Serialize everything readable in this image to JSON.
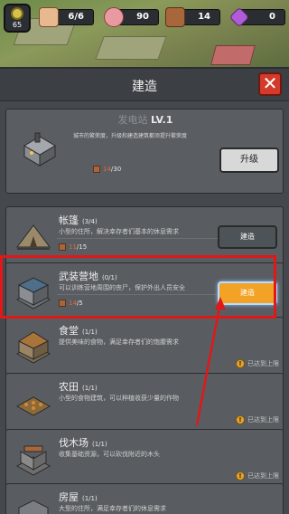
{
  "topbar": {
    "level": "65",
    "resources": [
      {
        "icon": "people-icon",
        "value": "6/6"
      },
      {
        "icon": "meat-icon",
        "value": "90"
      },
      {
        "icon": "wood-icon",
        "value": "14"
      },
      {
        "icon": "gem-icon",
        "value": "0"
      }
    ]
  },
  "modal": {
    "title": "建造",
    "close_label": "✕"
  },
  "power": {
    "name": "发电站",
    "level": "LV.1",
    "description": "城市的繁荣度，升级和建造建筑都须提升繁荣度",
    "cost_have": "14",
    "cost_need": "/30",
    "upgrade_label": "升级"
  },
  "buildings": [
    {
      "name": "帐篷",
      "count": "(3/4)",
      "description": "小型的住所，解决幸存者们基本的休息需求",
      "cost_have": "11",
      "cost_need": "/15",
      "button": "建造",
      "maxed": ""
    },
    {
      "name": "武装营地",
      "count": "(0/1)",
      "description": "可以训练营地周围的丧尸，保护外出人员安全",
      "cost_have": "14",
      "cost_need": "/5",
      "button": "建造",
      "maxed": ""
    },
    {
      "name": "食堂",
      "count": "(1/1)",
      "description": "提供美味的食物，满足幸存者们的饱腹需求",
      "cost_have": "",
      "cost_need": "",
      "button": "",
      "maxed": "已达到上限"
    },
    {
      "name": "农田",
      "count": "(1/1)",
      "description": "小型的食物建筑，可以种植收获少量的作物",
      "cost_have": "",
      "cost_need": "",
      "button": "",
      "maxed": "已达到上限"
    },
    {
      "name": "伐木场",
      "count": "(1/1)",
      "description": "收集基础资源，可以砍伐附近的木头",
      "cost_have": "",
      "cost_need": "",
      "button": "",
      "maxed": "已达到上限"
    },
    {
      "name": "房屋",
      "count": "(1/1)",
      "description": "大型的住所，满足幸存者们的休息需求",
      "cost_have": "",
      "cost_need": "",
      "button": "",
      "maxed": ""
    }
  ],
  "colors": {
    "accent_orange": "#f2a325",
    "highlight_red": "#e01818",
    "close_red": "#d43a2a"
  }
}
